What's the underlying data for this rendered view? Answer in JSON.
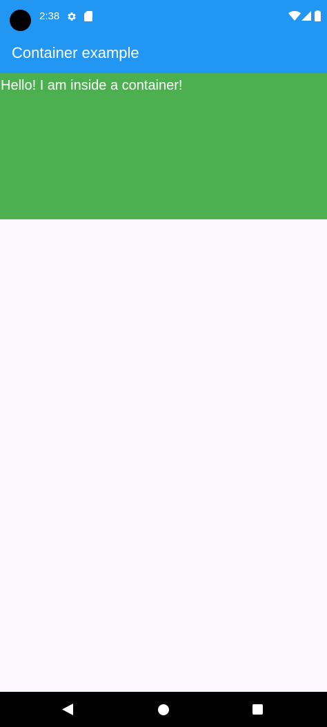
{
  "status_bar": {
    "time": "2:38",
    "icons": [
      "camera-cutout",
      "gear-icon",
      "sdcard-icon",
      "wifi-icon",
      "signal-icon",
      "battery-icon"
    ]
  },
  "app_bar": {
    "title": "Container example",
    "color": "#2196F3"
  },
  "container": {
    "text": "Hello! I am inside a container!",
    "color": "#4CAF50"
  },
  "navigation_bar": {
    "buttons": [
      "back",
      "home",
      "recents"
    ]
  }
}
